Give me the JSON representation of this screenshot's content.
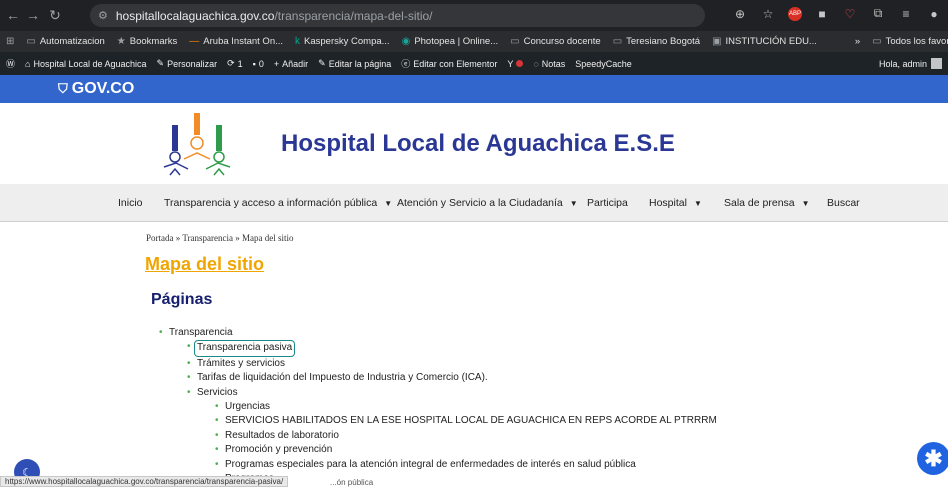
{
  "browser": {
    "url_host": "hospitallocalaguachica.gov.co",
    "url_path": "/transparencia/mapa-del-sitio/",
    "ext_label": "ABP"
  },
  "bookmarks": [
    {
      "label": "Automatizacion",
      "icon": "folder-icon"
    },
    {
      "label": "Bookmarks",
      "icon": "star-icon"
    },
    {
      "label": "Aruba Instant On...",
      "icon": "aruba-icon"
    },
    {
      "label": "Kaspersky Compa...",
      "icon": "kaspersky-icon"
    },
    {
      "label": "Photopea | Online...",
      "icon": "photopea-icon"
    },
    {
      "label": "Concurso docente",
      "icon": "folder-icon"
    },
    {
      "label": "Teresiano Bogotá",
      "icon": "folder-icon"
    },
    {
      "label": "INSTITUCIÓN EDU...",
      "icon": "site-icon"
    },
    {
      "label": "Todos los favoritos",
      "icon": "folder-icon"
    }
  ],
  "wpbar": {
    "site": "Hospital Local de Aguachica",
    "customize": "Personalizar",
    "updates": "1",
    "comments": "0",
    "add": "Añadir",
    "edit": "Editar la página",
    "elementor": "Editar con Elementor",
    "notes": "Notas",
    "speedy": "SpeedyCache",
    "greeting": "Hola, admin"
  },
  "gov": {
    "label": "GOV.CO"
  },
  "site": {
    "title": "Hospital Local de Aguachica E.S.E"
  },
  "nav": {
    "items": [
      {
        "label": "Inicio",
        "dropdown": false
      },
      {
        "label": "Transparencia y acceso a información pública",
        "dropdown": true
      },
      {
        "label": "Atención y Servicio a la Ciudadanía",
        "dropdown": true
      },
      {
        "label": "Participa",
        "dropdown": false
      },
      {
        "label": "Hospital",
        "dropdown": true
      },
      {
        "label": "Sala de prensa",
        "dropdown": true
      },
      {
        "label": "Buscar",
        "dropdown": false
      }
    ]
  },
  "content": {
    "breadcrumb": "Portada » Transparencia » Mapa del sitio",
    "page_title": "Mapa del sitio",
    "section_title": "Páginas",
    "tree": {
      "root": "Transparencia",
      "level2": [
        "Transparencia pasiva",
        "Trámites y servicios",
        "Tarifas de liquidación del Impuesto de Industria y Comercio (ICA).",
        "Servicios"
      ],
      "servicios": [
        "Urgencias",
        "SERVICIOS HABILITADOS EN LA ESE HOSPITAL LOCAL DE AGUACHICA EN REPS ACORDE AL PTRRRM",
        "Resultados de laboratorio",
        "Promoción y prevención",
        "Programas especiales para la atención integral de enfermedades de interés en salud pública",
        "Programas"
      ]
    }
  },
  "status": {
    "link": "https://www.hospitallocalaguachica.gov.co/transparencia/transparencia-pasiva/",
    "tail": "...ón pública"
  }
}
